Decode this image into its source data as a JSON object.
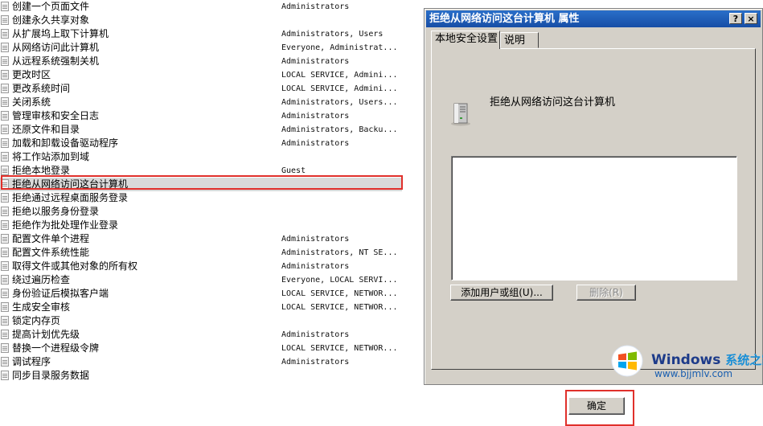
{
  "policies": [
    {
      "name": "创建一个页面文件",
      "value": "Administrators"
    },
    {
      "name": "创建永久共享对象",
      "value": ""
    },
    {
      "name": "从扩展坞上取下计算机",
      "value": "Administrators, Users"
    },
    {
      "name": "从网络访问此计算机",
      "value": "Everyone, Administrat..."
    },
    {
      "name": "从远程系统强制关机",
      "value": "Administrators"
    },
    {
      "name": "更改时区",
      "value": "LOCAL SERVICE, Admini..."
    },
    {
      "name": "更改系统时间",
      "value": "LOCAL SERVICE, Admini..."
    },
    {
      "name": "关闭系统",
      "value": "Administrators, Users..."
    },
    {
      "name": "管理审核和安全日志",
      "value": "Administrators"
    },
    {
      "name": "还原文件和目录",
      "value": "Administrators, Backu..."
    },
    {
      "name": "加载和卸载设备驱动程序",
      "value": "Administrators"
    },
    {
      "name": "将工作站添加到域",
      "value": ""
    },
    {
      "name": "拒绝本地登录",
      "value": "Guest"
    },
    {
      "name": "拒绝从网络访问这台计算机",
      "value": ""
    },
    {
      "name": "拒绝通过远程桌面服务登录",
      "value": ""
    },
    {
      "name": "拒绝以服务身份登录",
      "value": ""
    },
    {
      "name": "拒绝作为批处理作业登录",
      "value": ""
    },
    {
      "name": "配置文件单个进程",
      "value": "Administrators"
    },
    {
      "name": "配置文件系统性能",
      "value": "Administrators, NT SE..."
    },
    {
      "name": "取得文件或其他对象的所有权",
      "value": "Administrators"
    },
    {
      "name": "绕过遍历检查",
      "value": "Everyone, LOCAL SERVI..."
    },
    {
      "name": "身份验证后模拟客户端",
      "value": "LOCAL SERVICE, NETWOR..."
    },
    {
      "name": "生成安全审核",
      "value": "LOCAL SERVICE, NETWOR..."
    },
    {
      "name": "锁定内存页",
      "value": ""
    },
    {
      "name": "提高计划优先级",
      "value": "Administrators"
    },
    {
      "name": "替换一个进程级令牌",
      "value": "LOCAL SERVICE, NETWOR..."
    },
    {
      "name": "调试程序",
      "value": "Administrators"
    },
    {
      "name": "同步目录服务数据",
      "value": ""
    }
  ],
  "selected_index": 13,
  "dialog": {
    "title": "拒绝从网络访问这台计算机 属性",
    "help": "?",
    "close": "×",
    "tabs": [
      "本地安全设置",
      "说明"
    ],
    "policy_name": "拒绝从网络访问这台计算机",
    "add_button": "添加用户或组(U)...",
    "remove_button": "删除(R)",
    "ok_button": "确定"
  },
  "watermark": {
    "brand": "Windows",
    "brand_cn": "系统之家",
    "url": "www.bjjmlv.com"
  },
  "colors": {
    "highlight": "#e0302b",
    "titlebar": "#174ea6",
    "dialog_bg": "#d4d0c8"
  }
}
